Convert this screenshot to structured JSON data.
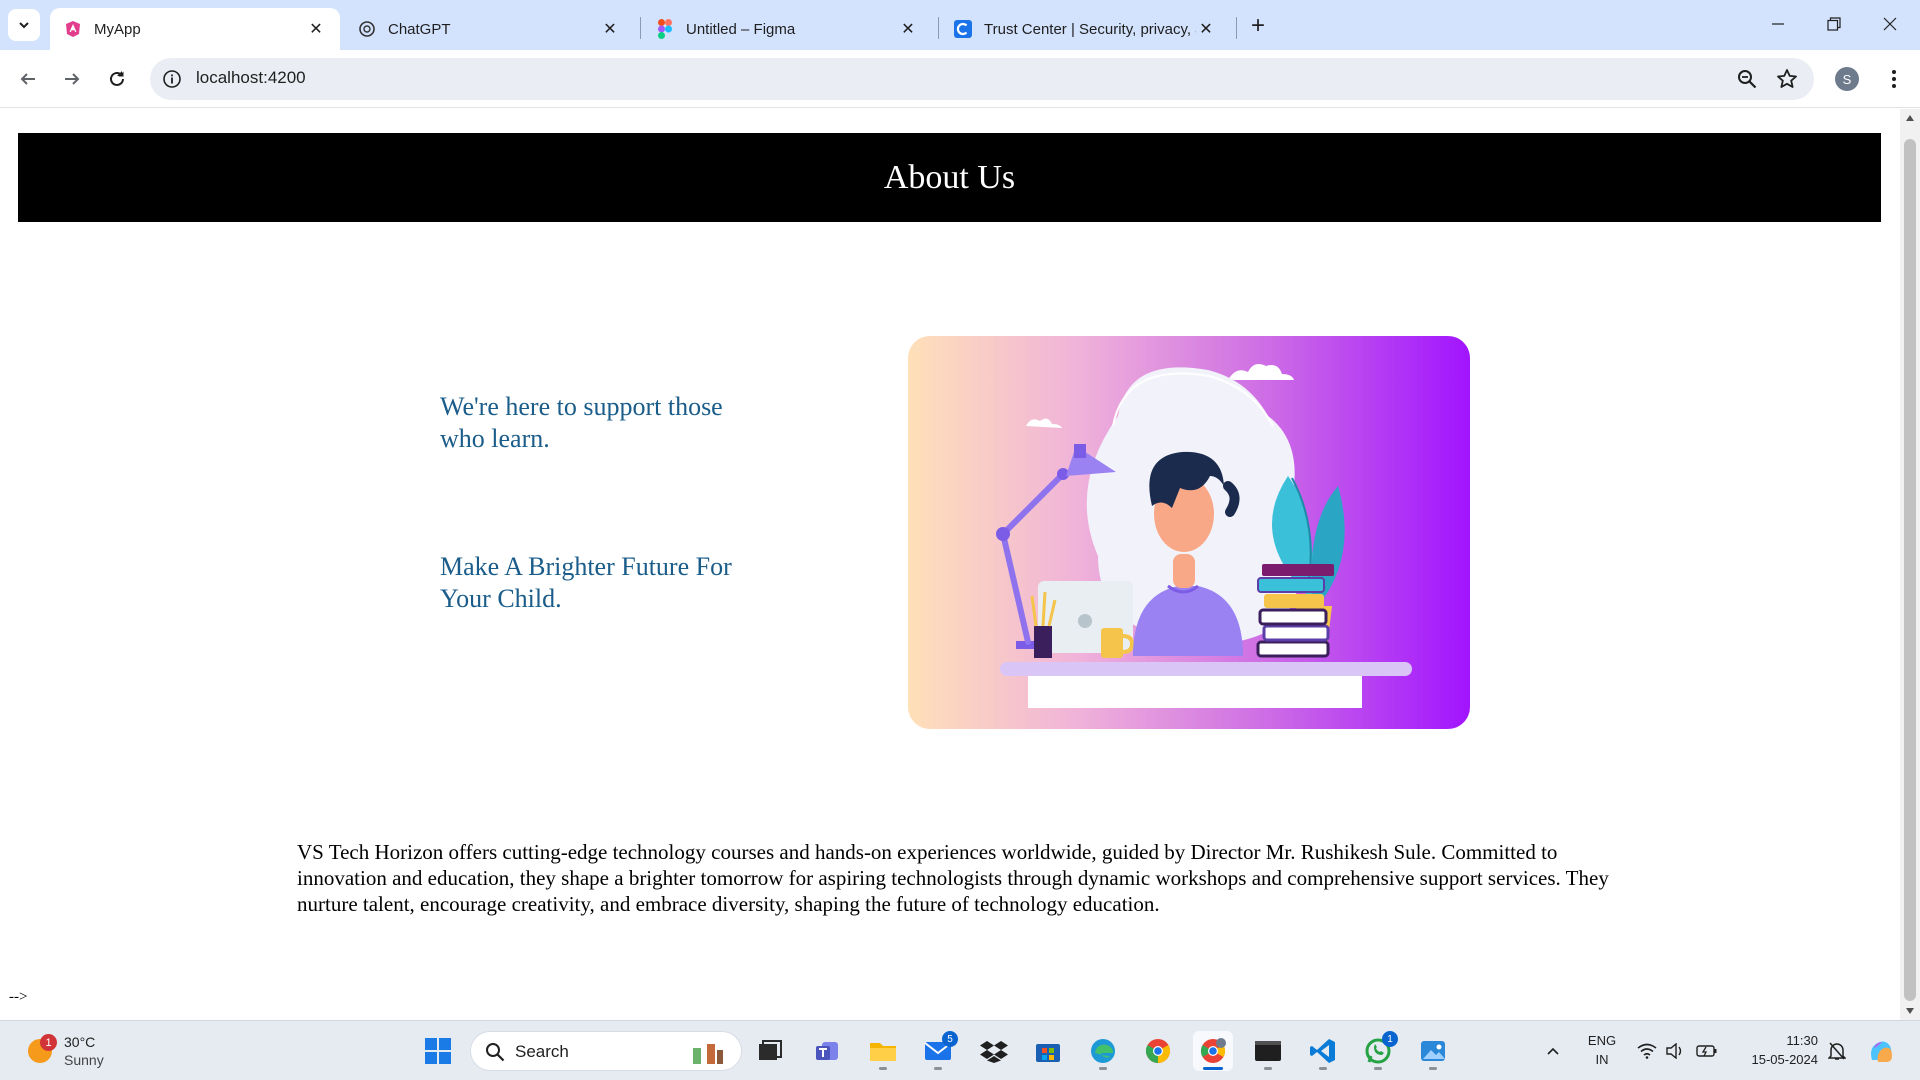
{
  "browser": {
    "tabs": [
      {
        "title": "MyApp",
        "favicon": "angular-icon",
        "active": true
      },
      {
        "title": "ChatGPT",
        "favicon": "chatgpt-icon",
        "active": false
      },
      {
        "title": "Untitled – Figma",
        "favicon": "figma-icon",
        "active": false
      },
      {
        "title": "Trust Center | Security, privacy, a",
        "favicon": "trust-center-icon",
        "active": false
      }
    ],
    "address": "localhost:4200",
    "profile_initial": "S"
  },
  "page": {
    "banner_title": "About Us",
    "tagline_1": "We're here to support those who learn.",
    "tagline_2": "Make A Brighter Future For Your Child.",
    "about_paragraph": "VS Tech Horizon offers cutting-edge technology courses and hands-on experiences worldwide, guided by Director Mr. Rushikesh Sule. Committed to innovation and education, they shape a brighter tomorrow for aspiring technologists through dynamic workshops and comprehensive support services. They nurture talent, encourage creativity, and embrace diversity, shaping the future of technology education.",
    "stray_text": "-->",
    "hero_image": "student-studying-at-desk-illustration"
  },
  "taskbar": {
    "weather": {
      "temp": "30°C",
      "condition": "Sunny",
      "badge": "1"
    },
    "search_label": "Search",
    "apps": [
      {
        "name": "start-icon"
      },
      {
        "name": "task-view-icon"
      },
      {
        "name": "teams-icon"
      },
      {
        "name": "file-explorer-icon"
      },
      {
        "name": "mail-icon",
        "badge": "5"
      },
      {
        "name": "dropbox-icon"
      },
      {
        "name": "microsoft-store-icon"
      },
      {
        "name": "edge-icon"
      },
      {
        "name": "chrome-icon"
      },
      {
        "name": "chrome-profile-icon",
        "active": true
      },
      {
        "name": "terminal-icon"
      },
      {
        "name": "vscode-icon"
      },
      {
        "name": "whatsapp-icon",
        "badge": "1"
      },
      {
        "name": "photos-icon"
      }
    ],
    "language": "ENG",
    "region": "IN",
    "time": "11:30",
    "date": "15-05-2024"
  },
  "colors": {
    "tabstrip": "#d3e3fd",
    "banner": "#000000",
    "tagline": "#1a5c8a",
    "hero_gradient_start": "#ffe0b8",
    "hero_gradient_end": "#a114ff"
  }
}
